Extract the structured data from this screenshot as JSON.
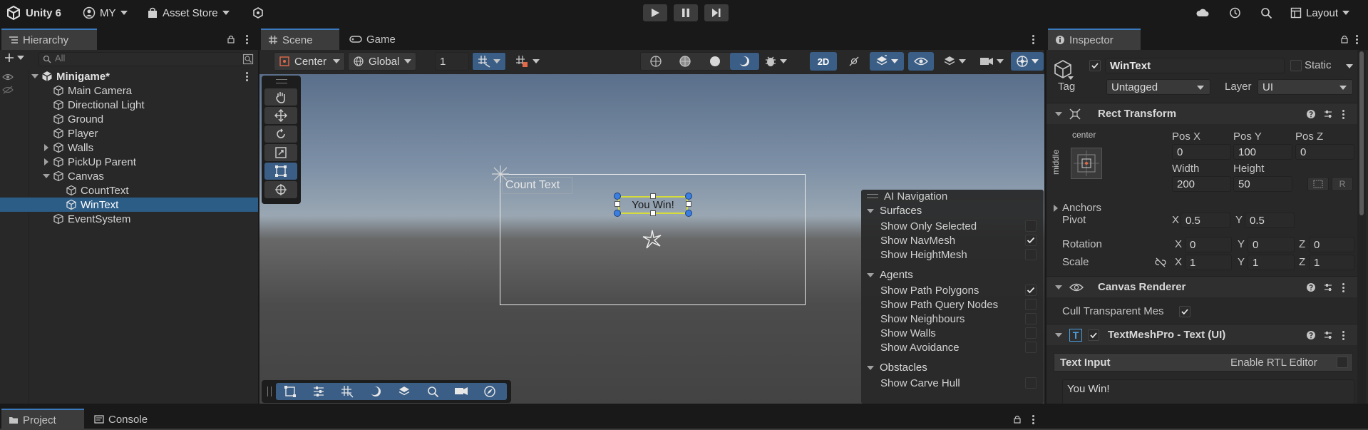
{
  "topbar": {
    "product": "Unity 6",
    "account": "MY",
    "asset_store": "Asset Store",
    "layout": "Layout"
  },
  "hierarchy": {
    "tab": "Hierarchy",
    "search_placeholder": "All",
    "scene_name": "Minigame*",
    "items": [
      {
        "label": "Main Camera"
      },
      {
        "label": "Directional Light"
      },
      {
        "label": "Ground"
      },
      {
        "label": "Player"
      },
      {
        "label": "Walls"
      },
      {
        "label": "PickUp Parent"
      },
      {
        "label": "Canvas"
      },
      {
        "label": "CountText"
      },
      {
        "label": "WinText"
      },
      {
        "label": "EventSystem"
      }
    ]
  },
  "scene": {
    "tabs": [
      {
        "label": "Scene"
      },
      {
        "label": "Game"
      }
    ],
    "pivot": "Center",
    "space": "Global",
    "snap_value": "1",
    "mode_2d": "2D",
    "count_text": "Count Text",
    "win_text": "You Win!"
  },
  "ai_nav": {
    "title": "AI Navigation",
    "surfaces": {
      "header": "Surfaces",
      "items": [
        {
          "label": "Show Only Selected",
          "checked": false
        },
        {
          "label": "Show NavMesh",
          "checked": true
        },
        {
          "label": "Show HeightMesh",
          "checked": false
        }
      ]
    },
    "agents": {
      "header": "Agents",
      "items": [
        {
          "label": "Show Path Polygons",
          "checked": true
        },
        {
          "label": "Show Path Query Nodes",
          "checked": false
        },
        {
          "label": "Show Neighbours",
          "checked": false
        },
        {
          "label": "Show Walls",
          "checked": false
        },
        {
          "label": "Show Avoidance",
          "checked": false
        }
      ]
    },
    "obstacles": {
      "header": "Obstacles",
      "items": [
        {
          "label": "Show Carve Hull",
          "checked": false
        }
      ]
    }
  },
  "inspector": {
    "tab": "Inspector",
    "object_name": "WinText",
    "static_label": "Static",
    "tag_label": "Tag",
    "tag_value": "Untagged",
    "layer_label": "Layer",
    "layer_value": "UI",
    "rect_transform": {
      "title": "Rect Transform",
      "anchor_h": "center",
      "anchor_v": "middle",
      "pos_x_label": "Pos X",
      "pos_x": "0",
      "pos_y_label": "Pos Y",
      "pos_y": "100",
      "pos_z_label": "Pos Z",
      "pos_z": "0",
      "width_label": "Width",
      "width": "200",
      "height_label": "Height",
      "height": "50",
      "r_label": "R",
      "anchors_label": "Anchors",
      "pivot_label": "Pivot",
      "pivot_x": "0.5",
      "pivot_y": "0.5",
      "rotation_label": "Rotation",
      "rot_x": "0",
      "rot_y": "0",
      "rot_z": "0",
      "scale_label": "Scale",
      "scale_x": "1",
      "scale_y": "1",
      "scale_z": "1",
      "x": "X",
      "y": "Y",
      "z": "Z"
    },
    "canvas_renderer": {
      "title": "Canvas Renderer",
      "cull_label": "Cull Transparent Mes"
    },
    "tmp": {
      "title": "TextMeshPro - Text (UI)",
      "text_input_label": "Text Input",
      "rtl_label": "Enable RTL Editor",
      "text_value": "You Win!"
    }
  },
  "bottom": {
    "tabs": [
      {
        "label": "Project"
      },
      {
        "label": "Console"
      }
    ]
  },
  "colors": {
    "accent": "#3a79bb",
    "selection": "#2c5d87",
    "panel": "#282828",
    "background": "#191919"
  }
}
